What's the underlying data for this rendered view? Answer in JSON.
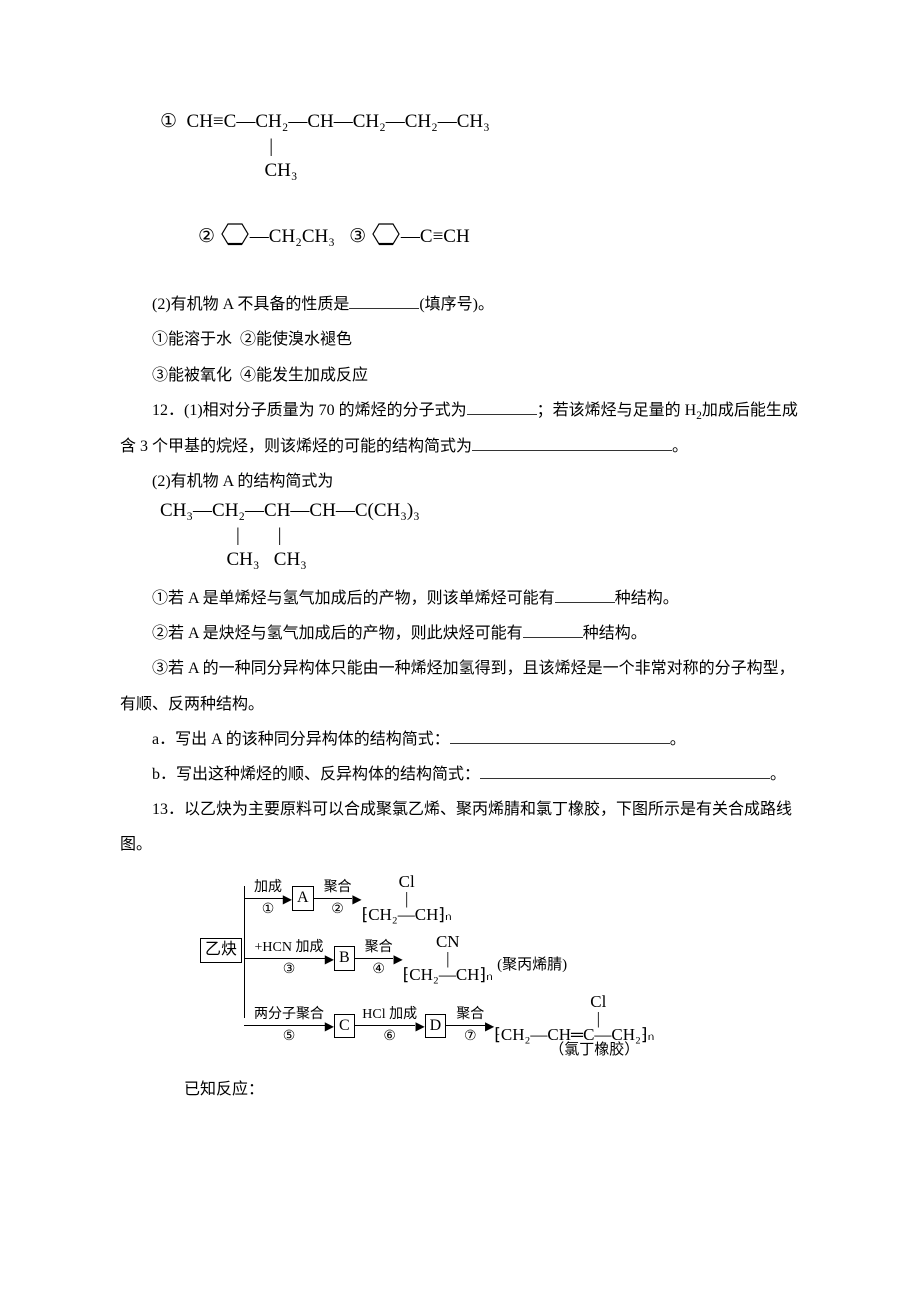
{
  "formulas": {
    "opt1_line1": "①  CH≡C—CH₂—CH—CH₂—CH₂—CH₃",
    "opt1_line2": "                       |",
    "opt1_line3": "                      CH₃",
    "opt2_prefix": "② ",
    "opt2_tail": "—CH₂CH₃",
    "opt3_prefix": "   ③ ",
    "opt3_tail": "—C≡CH"
  },
  "q_item2": {
    "prefix": "(2)有机物 A 不具备的性质是",
    "suffix": "(填序号)。",
    "o1": "①能溶于水",
    "o2": "②能使溴水褪色",
    "o3": "③能被氧化",
    "o4": "④能发生加成反应"
  },
  "q12": {
    "p1a": "12．(1)相对分子质量为 70 的烯烃的分子式为",
    "p1b": "；若该烯烃与足量的 H",
    "p1c": "加成后能生成含 3 个甲基的烷烃，则该烯烃的可能的结构简式为",
    "p1d": "。",
    "p2": "(2)有机物 A 的结构简式为",
    "formula_l1": "CH₃—CH₂—CH—CH—C(CH₃)₃",
    "formula_l2": "                |        |",
    "formula_l3": "              CH₃   CH₃",
    "s1a": "①若 A 是单烯烃与氢气加成后的产物，则该单烯烃可能有",
    "s1b": "种结构。",
    "s2a": "②若 A 是炔烃与氢气加成后的产物，则此炔烃可能有",
    "s2b": "种结构。",
    "s3": "③若 A 的一种同分异构体只能由一种烯烃加氢得到，且该烯烃是一个非常对称的分子构型，有顺、反两种结构。",
    "sa": "a．写出 A 的该种同分异构体的结构简式：",
    "sb": "b．写出这种烯烃的顺、反异构体的结构简式："
  },
  "q13": {
    "intro": "13．以乙炔为主要原料可以合成聚氯乙烯、聚丙烯腈和氯丁橡胶，下图所示是有关合成路线图。",
    "known": "已知反应："
  },
  "scheme": {
    "start": "乙炔",
    "r1top": "加成",
    "r1bot": "①",
    "nodeA": "A",
    "r2top": "聚合",
    "r2bot": "②",
    "prod1_sub": "Cl",
    "prod1_main": "⁅CH₂—CH⁆ₙ",
    "r3top": "+HCN 加成",
    "r3bot": "③",
    "nodeB": "B",
    "r4top": "聚合",
    "r4bot": "④",
    "prod2_sub": "CN",
    "prod2_main": "⁅CH₂—CH⁆ₙ",
    "prod2_name": "(聚丙烯腈)",
    "r5top": "两分子聚合",
    "r5bot": "⑤",
    "nodeC": "C",
    "r6top": "HCl 加成",
    "r6bot": "⑥",
    "nodeD": "D",
    "r7top": "聚合",
    "r7bot": "⑦",
    "prod3_sub": "Cl",
    "prod3_main1": "⁅CH₂—CH═C—CH₂⁆ₙ",
    "prod3_name": "（氯丁橡胶）"
  }
}
